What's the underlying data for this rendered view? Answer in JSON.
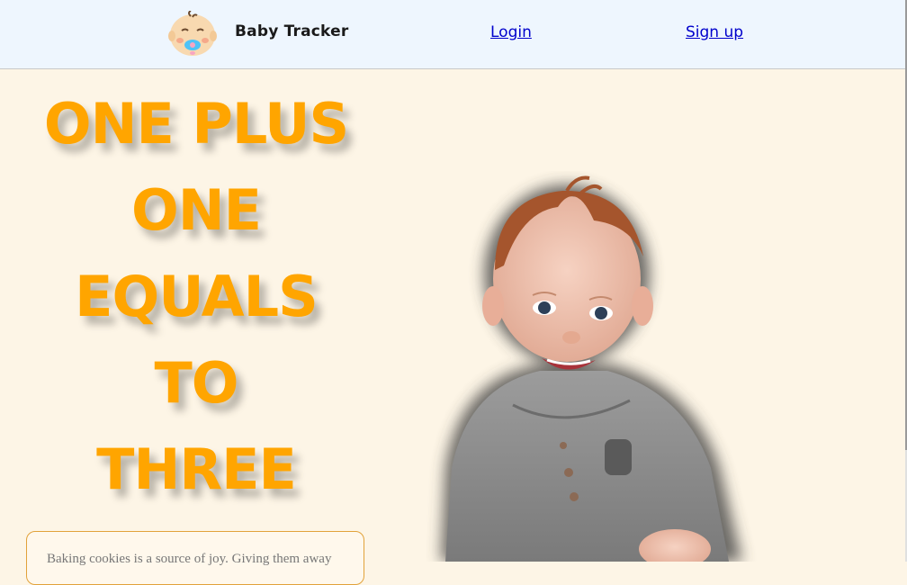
{
  "header": {
    "brand": "Baby Tracker",
    "login": "Login",
    "signup": "Sign up"
  },
  "hero": {
    "lines": [
      "ONE PLUS",
      "ONE",
      "EQUALS",
      "TO",
      "THREE"
    ]
  },
  "quote": {
    "text": "Baking cookies is a source of joy. Giving them away"
  },
  "colors": {
    "background": "#fdf5e6",
    "nav_background": "#eef6fe",
    "hero_text": "#ffa500",
    "link": "#0000cc"
  }
}
